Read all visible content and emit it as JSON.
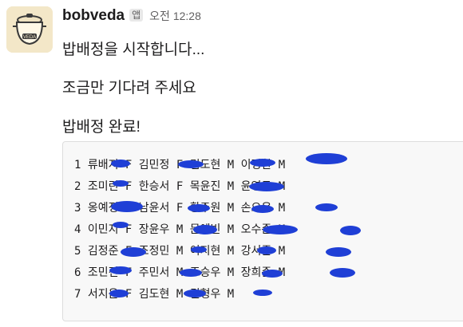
{
  "message": {
    "sender": "bobveda",
    "app_badge": "앱",
    "time": "오전 12:28",
    "lines": [
      "밥배정을 시작합니다...",
      "조금만 기다려 주세요",
      "밥배정 완료!"
    ],
    "code_rows": [
      "1 류배지 F 김민정 F 김도현 M 이정환 M",
      "2 조미린 F 한승서 F 목윤진 M 윤영두 M",
      "3 옹예정 F 남윤서 F 황주원 M 손으은 M",
      "4 이민지 F 장윤우 M 문예빈 M 오수준 M",
      "5 김정준 F 조정민 M 이지현 M 강서준 M",
      "6 조민진 F 주민서 M 조승우 M 장희준 M",
      "7 서지윤 F 김도현 M 권형우 M"
    ]
  },
  "avatar": {
    "label": "VEDA",
    "icon": "rice-cooker-icon"
  },
  "colors": {
    "background": "#ffffff",
    "code_bg": "#f8f8f8",
    "redaction": "#1f3fd6"
  }
}
